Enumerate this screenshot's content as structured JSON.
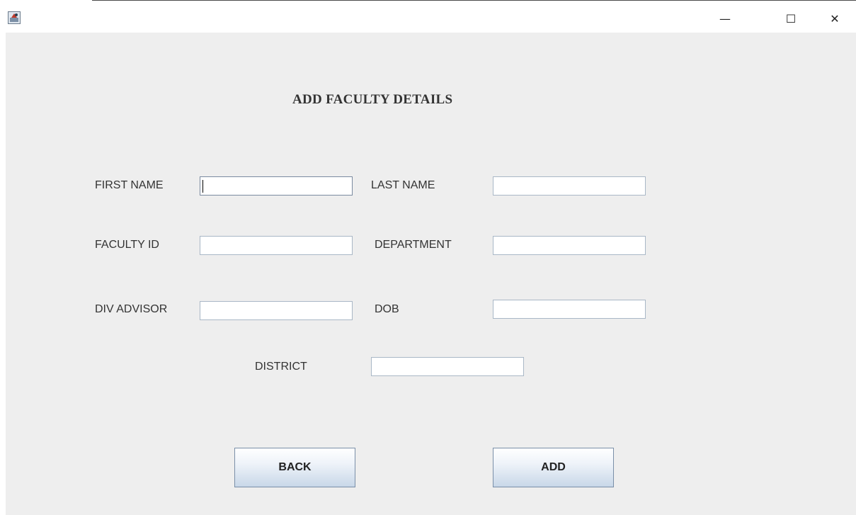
{
  "window": {
    "minimize_glyph": "—",
    "maximize_glyph": "☐",
    "close_glyph": "✕"
  },
  "form": {
    "title": "ADD FACULTY DETAILS",
    "fields": {
      "first_name": {
        "label": "FIRST NAME",
        "value": ""
      },
      "last_name": {
        "label": "LAST NAME",
        "value": ""
      },
      "faculty_id": {
        "label": "FACULTY ID",
        "value": ""
      },
      "department": {
        "label": "DEPARTMENT",
        "value": ""
      },
      "div_advisor": {
        "label": "DIV ADVISOR",
        "value": ""
      },
      "dob": {
        "label": "DOB",
        "value": ""
      },
      "district": {
        "label": "DISTRICT",
        "value": ""
      }
    },
    "buttons": {
      "back": "BACK",
      "add": "ADD"
    }
  },
  "icons": {
    "app": "java-app-icon",
    "minimize": "minimize-icon",
    "maximize": "maximize-icon",
    "close": "close-icon"
  }
}
